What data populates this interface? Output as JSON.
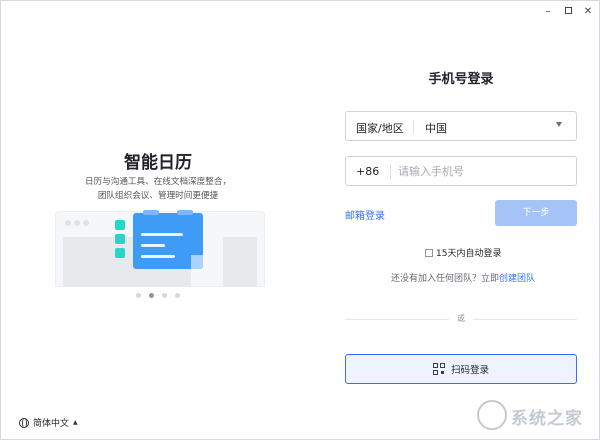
{
  "window": {
    "controls": {
      "minimize": "–",
      "close": "✕"
    }
  },
  "left": {
    "title": "智能日历",
    "desc_line1": "日历与沟通工具、在线文档深度整合，",
    "desc_line2": "团队组织会议、管理时间更便捷",
    "carousel": {
      "count": 4,
      "active_index": 1
    },
    "language": {
      "label": "简体中文",
      "caret": "▲"
    }
  },
  "form": {
    "title": "手机号登录",
    "region_label": "国家/地区",
    "region_value": "中国",
    "phone_code": "+86",
    "phone_placeholder": "请输入手机号",
    "email_login": "邮箱登录",
    "next": "下一步",
    "auto_login": "15天内自动登录",
    "no_team_text": "还没有加入任何团队？立即",
    "create_team": "创建团队",
    "or_text": "或",
    "qr_login": "扫码登录"
  },
  "watermark": {
    "text": "系统之家"
  },
  "colors": {
    "accent": "#3370ff",
    "next_button": "#a6c3f8",
    "qr_button_bg": "#eef3ff",
    "illustration_blue": "#3e9cf7",
    "illustration_teal": "#2bd4c8"
  },
  "icons": [
    "minimize-icon",
    "maximize-icon",
    "close-icon",
    "globe-icon",
    "chevron-down-icon",
    "qr-code-icon",
    "checkbox-icon"
  ]
}
